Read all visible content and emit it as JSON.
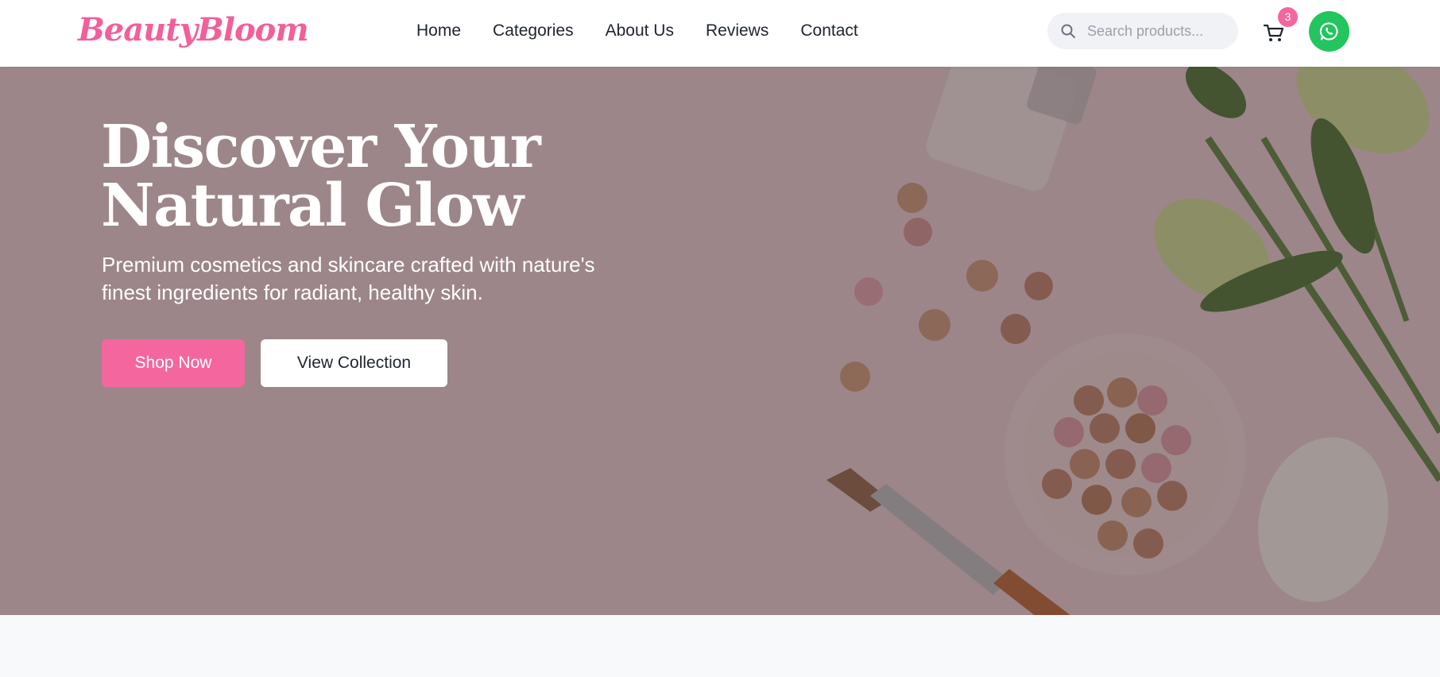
{
  "brand": {
    "logo": "BeautyBloom",
    "accent": "#f4679e",
    "whatsapp_color": "#22c55e"
  },
  "nav": {
    "items": [
      {
        "label": "Home"
      },
      {
        "label": "Categories"
      },
      {
        "label": "About Us"
      },
      {
        "label": "Reviews"
      },
      {
        "label": "Contact"
      }
    ]
  },
  "search": {
    "placeholder": "Search products...",
    "value": "",
    "icon": "search-icon"
  },
  "cart": {
    "count": "3",
    "icon": "cart-icon"
  },
  "whatsapp": {
    "icon": "whatsapp-icon"
  },
  "hero": {
    "title": "Discover Your Natural Glow",
    "subtitle": "Premium cosmetics and skincare crafted with nature's finest ingredients for radiant, healthy skin.",
    "primary_button": "Shop Now",
    "secondary_button": "View Collection"
  }
}
